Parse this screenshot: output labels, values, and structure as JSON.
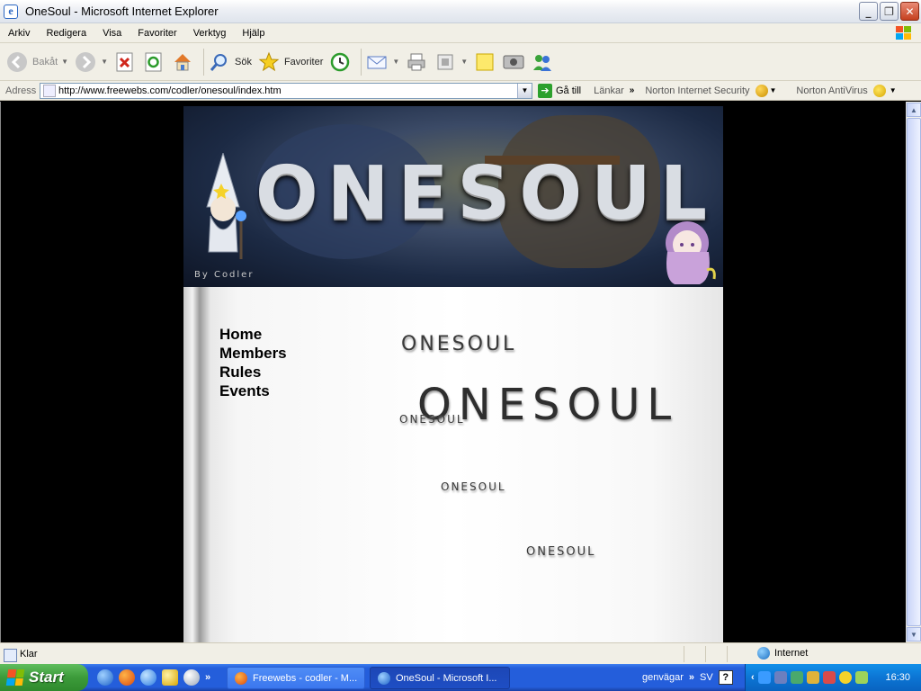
{
  "window": {
    "title": "OneSoul - Microsoft Internet Explorer",
    "controls": [
      "minimize",
      "restore",
      "close"
    ]
  },
  "menu": [
    "Arkiv",
    "Redigera",
    "Visa",
    "Favoriter",
    "Verktyg",
    "Hjälp"
  ],
  "toolbar": {
    "back_label": "Bakåt",
    "search_label": "Sök",
    "favorites_label": "Favoriter"
  },
  "address": {
    "label": "Adress",
    "url": "http://www.freewebs.com/codler/onesoul/index.htm",
    "go_label": "Gå till",
    "links_label": "Länkar",
    "norton_security": "Norton Internet Security",
    "norton_antivirus": "Norton AntiVirus"
  },
  "site": {
    "banner_logo": "ONESOUL",
    "banner_byline": "By Codler",
    "nav": [
      "Home",
      "Members",
      "Rules",
      "Events"
    ],
    "stamps": [
      "ONESOUL",
      "ONESOUL",
      "ONESOUL",
      "ONESOUL",
      "ONESOUL"
    ]
  },
  "status": {
    "text": "Klar",
    "zone": "Internet"
  },
  "taskbar": {
    "start_label": "Start",
    "tasks": [
      "Freewebs - codler - M...",
      "OneSoul - Microsoft I..."
    ],
    "toolbar_label": "genvägar",
    "language": "SV",
    "help": "?",
    "clock": "16:30"
  },
  "colors": {
    "taskbar_blue": "#245edb",
    "start_green": "#3c9b3a",
    "page_bg": "#000000"
  }
}
